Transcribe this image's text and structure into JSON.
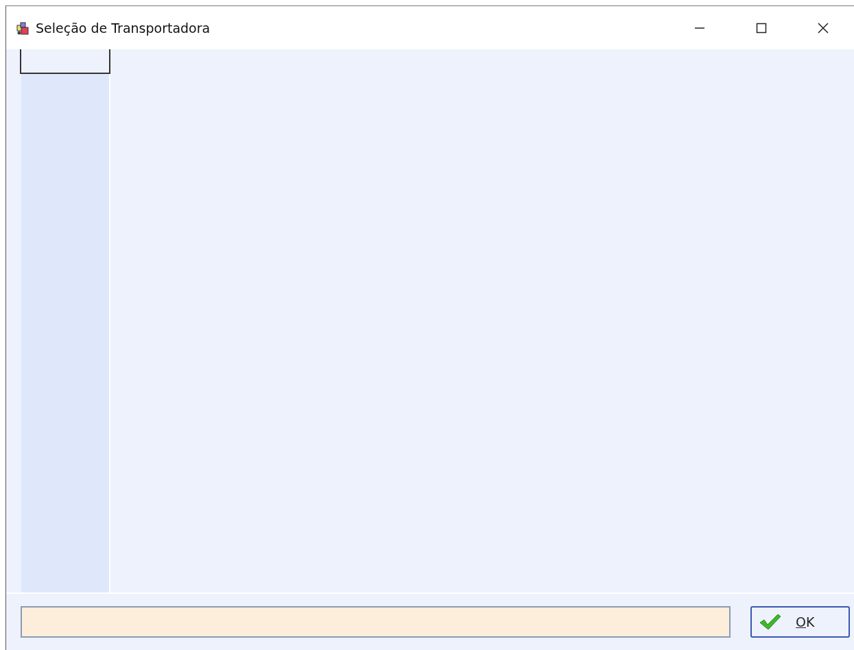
{
  "window": {
    "title": "Seleção de Transportadora"
  },
  "buttons": [
    {
      "label": "OK",
      "kind": "confirm"
    }
  ]
}
